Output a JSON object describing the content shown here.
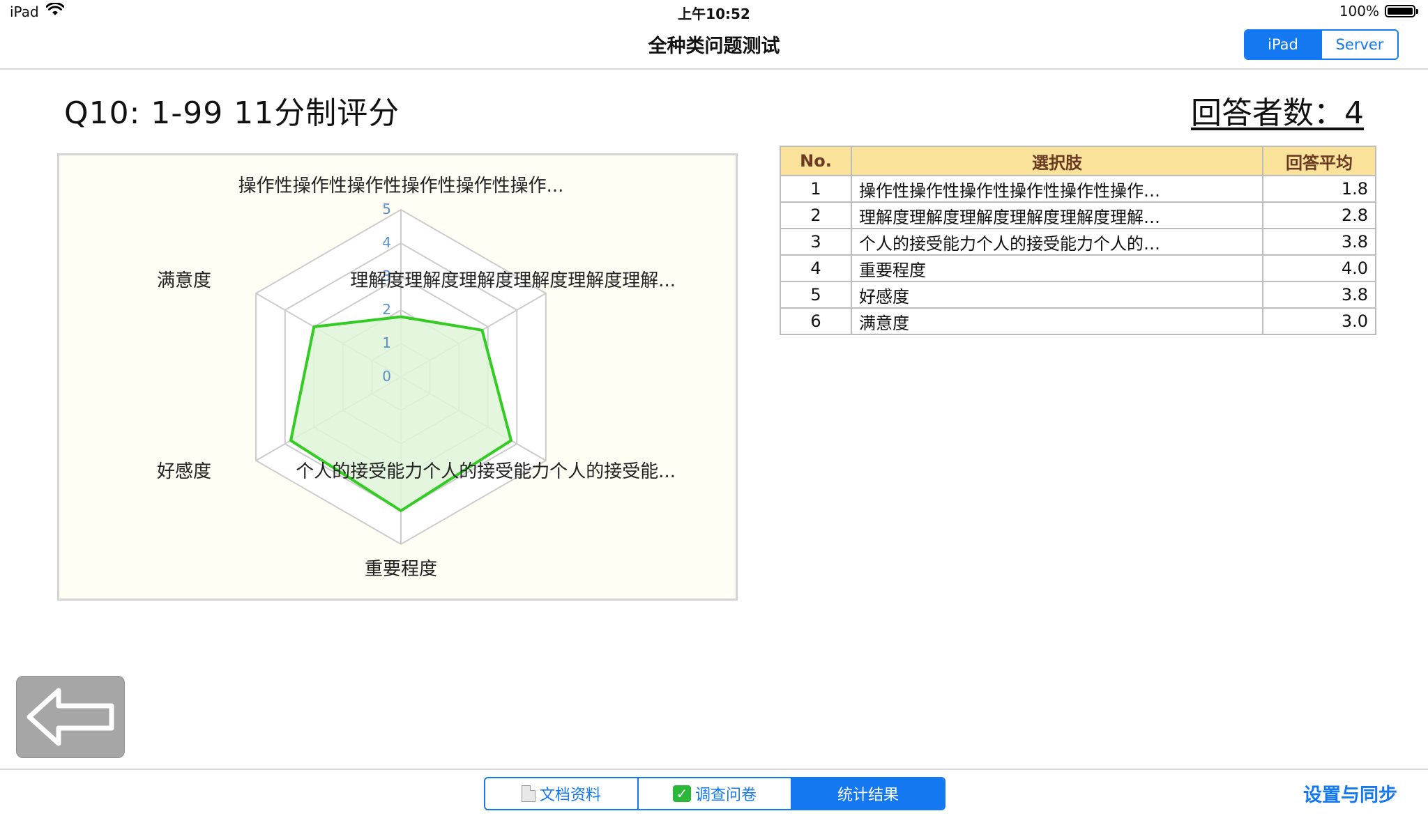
{
  "status": {
    "device": "iPad",
    "time": "上午10:52",
    "battery": "100%"
  },
  "nav": {
    "title": "全种类问题测试",
    "segments": [
      "iPad",
      "Server"
    ],
    "active_segment": 0
  },
  "question": {
    "title": "Q10: 1-99 11分制评分",
    "respondents": "回答者数：4"
  },
  "chart_data": {
    "type": "radar",
    "categories": [
      "操作性操作性操作性操作性操作性操作...",
      "理解度理解度理解度理解度理解度理解...",
      "个人的接受能力个人的接受能力个人的接受能...",
      "重要程度",
      "好感度",
      "满意度"
    ],
    "values": [
      1.8,
      2.8,
      3.8,
      4.0,
      3.8,
      3.0
    ],
    "rlim": [
      0,
      5
    ],
    "ticks": [
      "0",
      "1",
      "2",
      "3",
      "4",
      "5"
    ],
    "series_color": "#33cc22",
    "fill_color": "#dff5d8",
    "grid": true
  },
  "table": {
    "headers": [
      "No.",
      "選択肢",
      "回答平均"
    ],
    "rows": [
      {
        "no": "1",
        "label": "操作性操作性操作性操作性操作性操作…",
        "avg": "1.8"
      },
      {
        "no": "2",
        "label": "理解度理解度理解度理解度理解度理解…",
        "avg": "2.8"
      },
      {
        "no": "3",
        "label": "个人的接受能力个人的接受能力个人的…",
        "avg": "3.8"
      },
      {
        "no": "4",
        "label": "重要程度",
        "avg": "4.0"
      },
      {
        "no": "5",
        "label": "好感度",
        "avg": "3.8"
      },
      {
        "no": "6",
        "label": "满意度",
        "avg": "3.0"
      }
    ]
  },
  "bottom": {
    "tabs": [
      "文档资料",
      "调查问卷",
      "统计结果"
    ],
    "active_tab": 2,
    "settings": "设置与同步"
  },
  "icons": [
    "wifi-icon",
    "battery-icon",
    "back-arrow-icon",
    "document-icon",
    "checkbox-icon"
  ]
}
